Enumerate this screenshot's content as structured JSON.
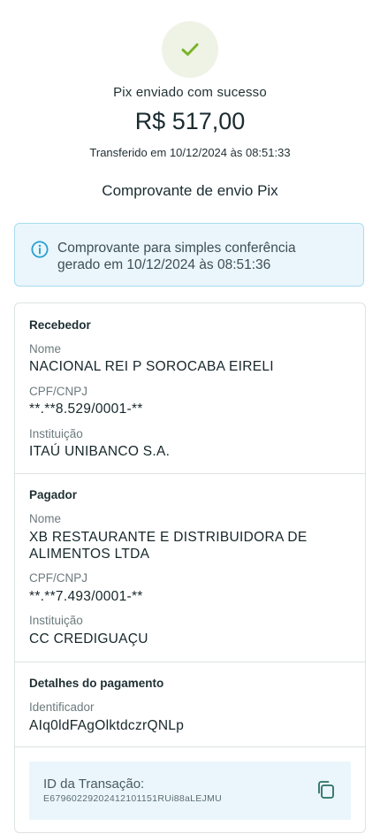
{
  "header": {
    "status": "Pix enviado com sucesso",
    "amount": "R$ 517,00",
    "transfer_datetime": "Transferido em 10/12/2024 às 08:51:33",
    "receipt_title": "Comprovante de envio Pix"
  },
  "info": {
    "line1": "Comprovante para simples conferência",
    "line2": "gerado em 10/12/2024 às 08:51:36"
  },
  "recebedor": {
    "title": "Recebedor",
    "nome_label": "Nome",
    "nome": "NACIONAL REI P SOROCABA EIRELI",
    "doc_label": "CPF/CNPJ",
    "doc": "**.**8.529/0001-**",
    "inst_label": "Instituição",
    "inst": "ITAÚ UNIBANCO S.A."
  },
  "pagador": {
    "title": "Pagador",
    "nome_label": "Nome",
    "nome_line1": "XB RESTAURANTE E DISTRIBUIDORA DE",
    "nome_line2": "ALIMENTOS LTDA",
    "doc_label": "CPF/CNPJ",
    "doc": "**.**7.493/0001-**",
    "inst_label": "Instituição",
    "inst": "CC CREDIGUAÇU"
  },
  "detalhes": {
    "title": "Detalhes do pagamento",
    "id_label": "Identificador",
    "id": "AIq0ldFAgOlktdczrQNLp"
  },
  "transacao": {
    "label": "ID da Transação:",
    "id": "E67960229202412101151RUi88aLEJMU"
  },
  "colors": {
    "success_bg": "#eef3e6",
    "check": "#7cb32a",
    "info_bg": "#eaf6fb",
    "info_border": "#a9dcef",
    "info_icon": "#2a9fd0",
    "copy_icon": "#2a6f64"
  },
  "icons": {
    "success": "check-icon",
    "info": "info-icon",
    "copy": "copy-icon"
  }
}
